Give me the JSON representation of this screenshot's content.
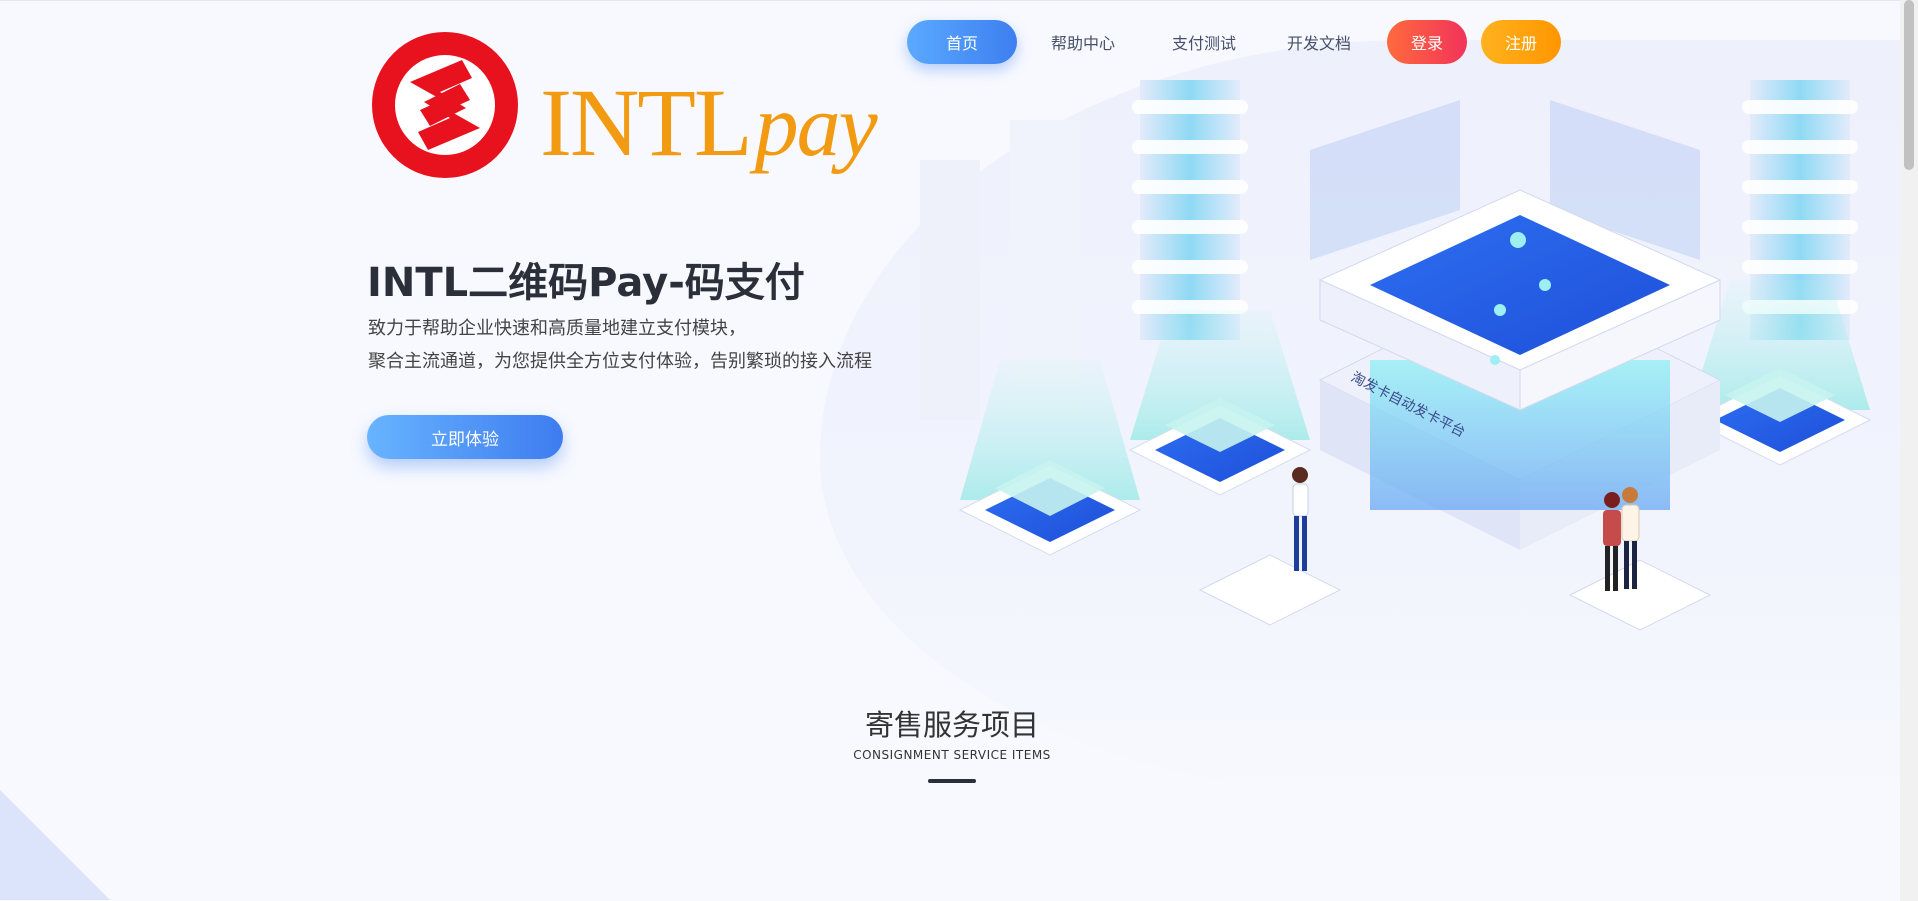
{
  "logo": {
    "word": "INTL",
    "word_italic": "pay",
    "mark_color": "#e8121f",
    "word_color": "#f29a11"
  },
  "nav": {
    "items": [
      {
        "label": "首页"
      },
      {
        "label": "帮助中心"
      },
      {
        "label": "支付测试"
      },
      {
        "label": "开发文档"
      },
      {
        "label": "登录"
      },
      {
        "label": "注册"
      }
    ]
  },
  "hero": {
    "title": "INTL二维码Pay-码支付",
    "line1": "致力于帮助企业快速和高质量地建立支付模块，",
    "line2": "聚合主流通道，为您提供全方位支付体验，告别繁琐的接入流程",
    "cta_label": "立即体验"
  },
  "illustration": {
    "platform_label": "淘发卡自动发卡平台"
  },
  "section": {
    "title": "寄售服务项目",
    "subtitle": "CONSIGNMENT SERVICE ITEMS"
  },
  "colors": {
    "accent_blue": "#3d7ff0",
    "login": "#f2335a",
    "register": "#ff9600",
    "background": "#f7f9fe"
  }
}
